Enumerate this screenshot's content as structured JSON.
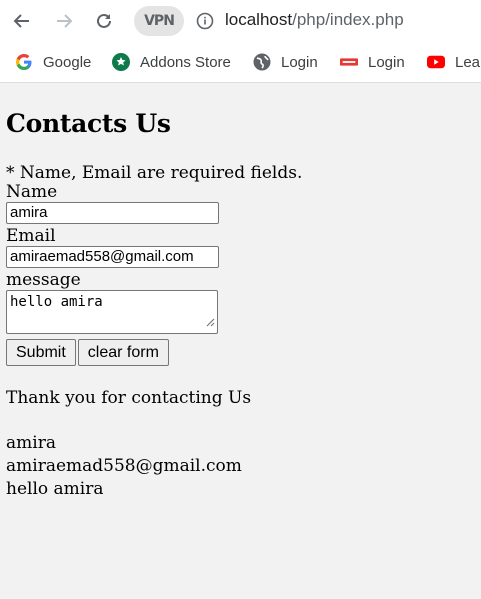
{
  "browser": {
    "url_host": "localhost",
    "url_path": "/php/index.php",
    "vpn_label": "VPN",
    "bookmarks": [
      {
        "label": "Google",
        "icon": "google-icon"
      },
      {
        "label": "Addons Store",
        "icon": "addons-icon"
      },
      {
        "label": "Login",
        "icon": "globe-icon"
      },
      {
        "label": "Login",
        "icon": "login-brand-icon"
      },
      {
        "label": "Lea",
        "icon": "youtube-icon"
      }
    ]
  },
  "page": {
    "title": "Contacts Us",
    "required_note": "* Name, Email are required fields.",
    "form": {
      "name_label": "Name",
      "name_value": "amira",
      "email_label": "Email",
      "email_value": "amiraemad558@gmail.com",
      "message_label": "message",
      "message_value": "hello amira",
      "submit_label": "Submit",
      "clear_label": "clear form"
    },
    "thanks": "Thank you for contacting Us",
    "output": {
      "name": "amira",
      "email": "amiraemad558@gmail.com",
      "message": "hello amira"
    }
  }
}
